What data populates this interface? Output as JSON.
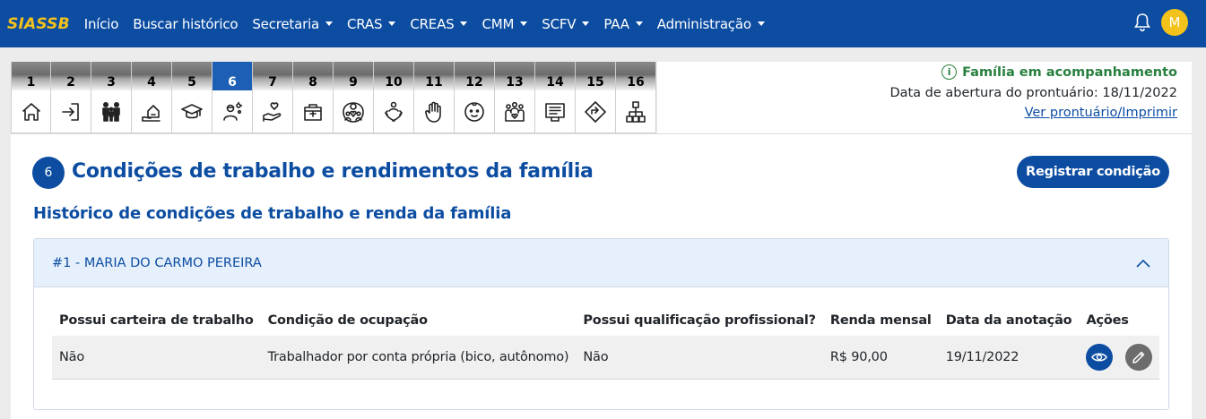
{
  "brand": "SIASSB",
  "nav": [
    {
      "label": "Início",
      "dropdown": false
    },
    {
      "label": "Buscar histórico",
      "dropdown": false
    },
    {
      "label": "Secretaria",
      "dropdown": true
    },
    {
      "label": "CRAS",
      "dropdown": true
    },
    {
      "label": "CREAS",
      "dropdown": true
    },
    {
      "label": "CMM",
      "dropdown": true
    },
    {
      "label": "SCFV",
      "dropdown": true
    },
    {
      "label": "PAA",
      "dropdown": true
    },
    {
      "label": "Administração",
      "dropdown": true
    }
  ],
  "user": {
    "initial": "M"
  },
  "steps": [
    {
      "num": "1",
      "icon": "home-icon"
    },
    {
      "num": "2",
      "icon": "login-icon"
    },
    {
      "num": "3",
      "icon": "family-icon"
    },
    {
      "num": "4",
      "icon": "hand-house-icon"
    },
    {
      "num": "5",
      "icon": "graduation-cap-icon"
    },
    {
      "num": "6",
      "icon": "worker-gear-icon"
    },
    {
      "num": "7",
      "icon": "hand-heart-icon"
    },
    {
      "num": "8",
      "icon": "medical-kit-icon"
    },
    {
      "num": "9",
      "icon": "group-heart-icon"
    },
    {
      "num": "10",
      "icon": "care-hands-icon"
    },
    {
      "num": "11",
      "icon": "stop-hand-icon"
    },
    {
      "num": "12",
      "icon": "baby-face-icon"
    },
    {
      "num": "13",
      "icon": "community-icon"
    },
    {
      "num": "14",
      "icon": "list-screen-icon"
    },
    {
      "num": "15",
      "icon": "direction-sign-icon"
    },
    {
      "num": "16",
      "icon": "sitemap-icon"
    }
  ],
  "active_step": "6",
  "status": {
    "badge": "Família em acompanhamento",
    "opening_date": "Data de abertura do prontuário: 18/11/2022",
    "link": "Ver prontuário/Imprimir"
  },
  "section": {
    "number": "6",
    "title": "Condições de trabalho e rendimentos da família",
    "register_button": "Registrar condição",
    "subtitle": "Histórico de condições de trabalho e renda da família"
  },
  "accordion": {
    "title": "#1 - MARIA DO CARMO PEREIRA",
    "columns": [
      "Possui carteira de trabalho",
      "Condição de ocupação",
      "Possui qualificação profissional?",
      "Renda mensal",
      "Data da anotação",
      "Ações"
    ],
    "rows": [
      [
        "Não",
        "Trabalhador por conta própria (bico, autônomo)",
        "Não",
        "R$ 90,00",
        "19/11/2022"
      ]
    ]
  },
  "colors": {
    "primary": "#0c4da2",
    "accent": "#f3c21b",
    "success": "#28803f"
  }
}
